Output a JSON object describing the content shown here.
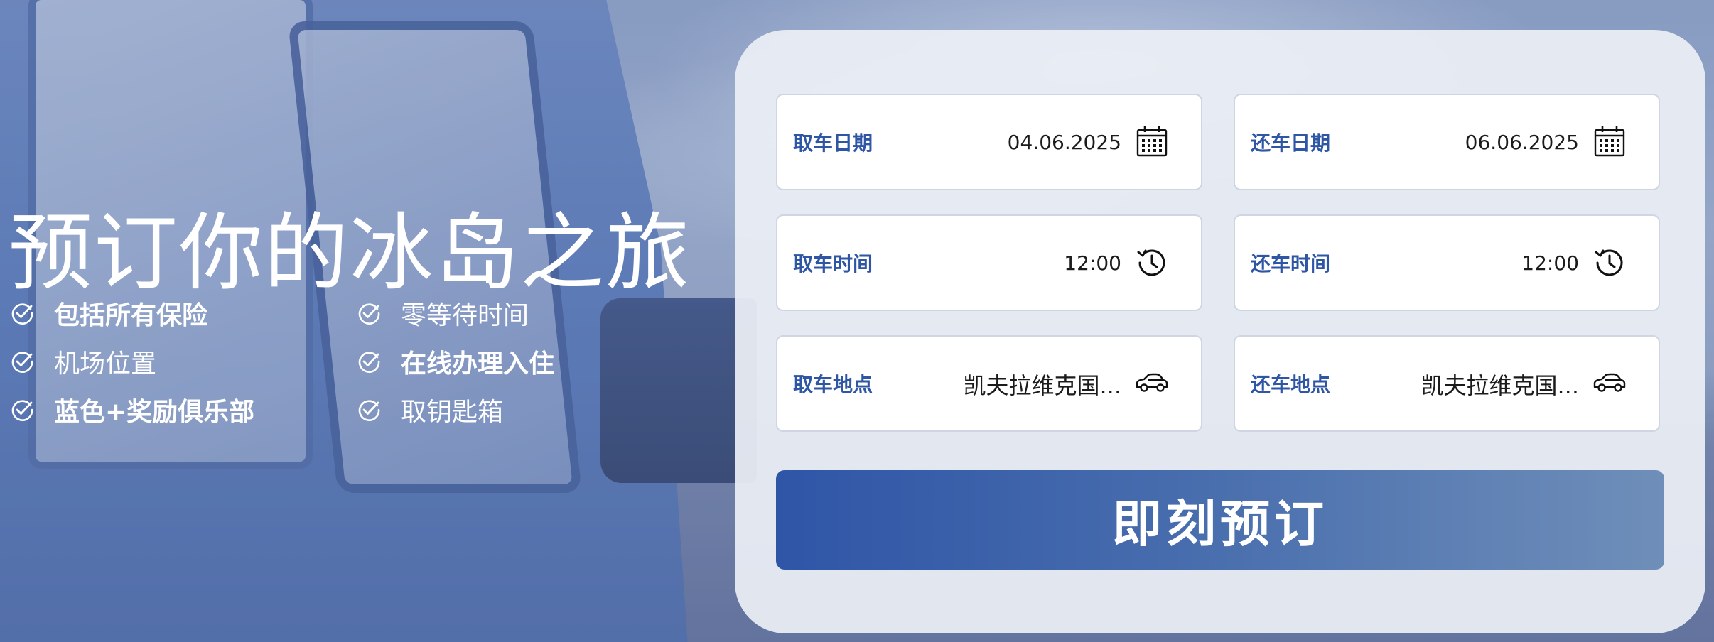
{
  "hero": {
    "title": "预订你的冰岛之旅"
  },
  "features": [
    {
      "label": "包括所有保险",
      "bold": true,
      "icon": "check-circle-icon"
    },
    {
      "label": "零等待时间",
      "bold": false,
      "icon": "check-circle-icon"
    },
    {
      "label": "机场位置",
      "bold": false,
      "icon": "check-circle-icon"
    },
    {
      "label": "在线办理入住",
      "bold": true,
      "icon": "check-circle-icon"
    },
    {
      "label": "蓝色+奖励俱乐部",
      "bold": true,
      "icon": "check-circle-icon"
    },
    {
      "label": "取钥匙箱",
      "bold": false,
      "icon": "check-circle-icon"
    }
  ],
  "booking": {
    "pickup_date": {
      "label": "取车日期",
      "value": "04.06.2025",
      "icon": "calendar-icon"
    },
    "return_date": {
      "label": "还车日期",
      "value": "06.06.2025",
      "icon": "calendar-icon"
    },
    "pickup_time": {
      "label": "取车时间",
      "value": "12:00",
      "icon": "clock-icon"
    },
    "return_time": {
      "label": "还车时间",
      "value": "12:00",
      "icon": "clock-icon"
    },
    "pickup_location": {
      "label": "取车地点",
      "value": "凯夫拉维克国...",
      "icon": "car-icon"
    },
    "return_location": {
      "label": "还车地点",
      "value": "凯夫拉维克国...",
      "icon": "car-icon"
    },
    "submit_label": "即刻预订"
  },
  "colors": {
    "accent": "#2e56a4",
    "button_start": "#2f55a7",
    "button_end": "#6f8fb9",
    "card_bg": "#eceff5"
  }
}
